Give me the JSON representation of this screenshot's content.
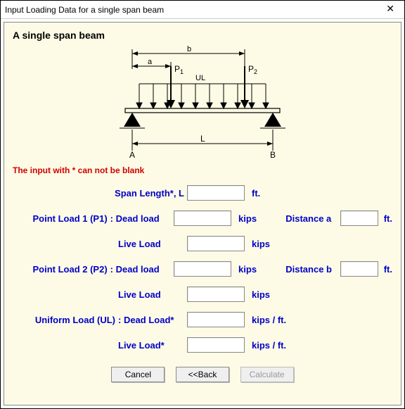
{
  "window": {
    "title": "Input Loading Data for a single span beam"
  },
  "heading": "A single span beam",
  "diagram": {
    "a": "a",
    "b": "b",
    "P1": "P",
    "P1sub": "1",
    "P2": "P",
    "P2sub": "2",
    "UL": "UL",
    "L": "L",
    "A": "A",
    "B": "B"
  },
  "warning": "The input with  * can not be blank",
  "fields": {
    "span": {
      "label": "Span Length*, L",
      "value": "",
      "unit": "ft."
    },
    "p1": {
      "label": "Point Load 1 (P1)",
      "dead": {
        "label": ": Dead load",
        "value": "",
        "unit": "kips"
      },
      "live": {
        "label": "Live Load",
        "value": "",
        "unit": "kips"
      },
      "dist": {
        "label": "Distance a",
        "value": "",
        "unit": "ft."
      }
    },
    "p2": {
      "label": "Point Load 2 (P2)",
      "dead": {
        "label": ": Dead load",
        "value": "",
        "unit": "kips"
      },
      "live": {
        "label": "Live Load",
        "value": "",
        "unit": "kips"
      },
      "dist": {
        "label": "Distance b",
        "value": "",
        "unit": "ft."
      }
    },
    "ul": {
      "label": "Uniform Load (UL)",
      "dead": {
        "label": ": Dead Load*",
        "value": "",
        "unit": "kips / ft."
      },
      "live": {
        "label": "Live Load*",
        "value": "",
        "unit": "kips / ft."
      }
    }
  },
  "buttons": {
    "cancel": "Cancel",
    "back": "<<Back",
    "calculate": "Calculate"
  }
}
